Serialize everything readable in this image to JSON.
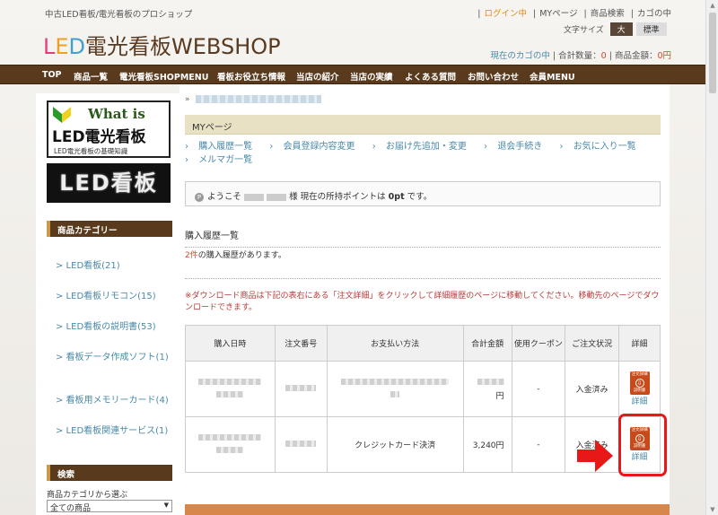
{
  "header": {
    "tagline": "中古LED看板/電光看板のプロショップ",
    "logo_parts": [
      "L",
      "E",
      "D",
      "電光看板WEBSHOP"
    ],
    "top_links": [
      "ログイン中",
      "MYページ",
      "商品検索",
      "カゴの中"
    ],
    "top_link_sep": "|",
    "font_size_label": "文字サイズ",
    "font_size_big": "大",
    "font_size_std": "標準",
    "cart_label": "現在のカゴの中",
    "cart_count_label": "合計数量：",
    "cart_count": "0",
    "cart_total_label": "商品金額：",
    "cart_total": "0円"
  },
  "nav": [
    "TOP",
    "商品一覧",
    "電光看板SHOPMENU",
    "看板お役立ち情報",
    "当店の紹介",
    "当店の実績",
    "よくある質問",
    "お問い合わせ",
    "会員MENU"
  ],
  "sidebar": {
    "banner1": {
      "title": "What is",
      "main": "LED電光看板",
      "sub": "LED電光看板の基礎知識"
    },
    "banner2": "LED看板",
    "category_head": "商品カテゴリー",
    "categories": [
      "> LED看板(21)",
      "> LED看板リモコン(15)",
      "> LED看板の説明書(53)",
      "> 看板データ作成ソフト(1)",
      "> 看板用メモリーカード(4)",
      "> LED看板関連サービス(1)"
    ],
    "search_head": "検索",
    "search_label": "商品カテゴリから選ぶ",
    "search_value": "全ての商品"
  },
  "main": {
    "crumb_prefix": "»",
    "title": "MYページ",
    "menu_links": [
      "購入履歴一覧",
      "会員登録内容変更",
      "お届け先追加・変更",
      "退会手続き",
      "お気に入り一覧",
      "メルマガ一覧"
    ],
    "menu_prefix": "›",
    "welcome_icon": "P",
    "welcome_prefix": "ようこそ",
    "welcome_suffix": "様 現在の所持ポイントは",
    "points": "0pt",
    "welcome_end": "です。",
    "history_title": "購入履歴一覧",
    "history_count": "2件",
    "history_count_text": "の購入履歴があります。",
    "notice": "※ダウンロード商品は下記の表右にある「注文詳細」をクリックして詳細履歴のページに移動してください。移動先のページでダウンロードできます。",
    "table": {
      "headers": [
        "購入日時",
        "注文番号",
        "お支払い方法",
        "合計金額",
        "使用クーポン",
        "ご注文状況",
        "詳細"
      ],
      "rows": [
        {
          "payment": "",
          "total_suffix": "円",
          "coupon": "-",
          "status": "入金済み",
          "icon_top": "注文詳細",
          "icon_bottom": "説明書",
          "detail": "詳細"
        },
        {
          "payment": "クレジットカード決済",
          "total": "3,240円",
          "coupon": "-",
          "status": "入金済み",
          "icon_top": "注文詳細",
          "icon_bottom": "説明書",
          "detail": "詳細"
        }
      ]
    }
  },
  "colors": {
    "nav_bg": "#5a3a1c",
    "link": "#4a8aa8",
    "accent_red": "#e81818",
    "icon_orange": "#c84a1a"
  }
}
